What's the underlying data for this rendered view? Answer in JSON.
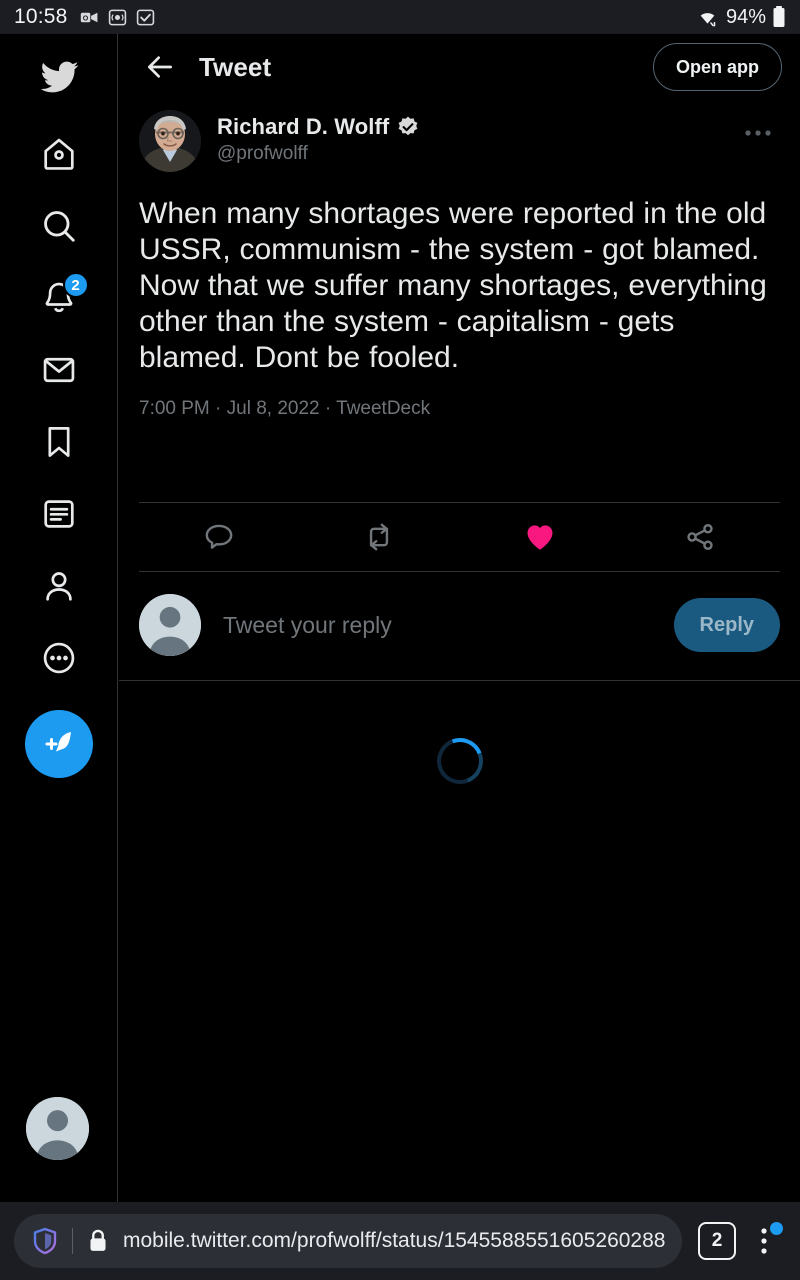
{
  "status_bar": {
    "clock": "10:58",
    "battery_percent": "94%",
    "icons": [
      "outlook-video-icon",
      "screen-record-icon",
      "checkbox-icon"
    ],
    "right_icons": [
      "wifi-icon",
      "battery-icon"
    ],
    "bg_color": "#1b1d22"
  },
  "sidebar": {
    "logo": "twitter-bird-logo",
    "items": [
      {
        "name": "home",
        "icon": "home-icon",
        "badge": ""
      },
      {
        "name": "explore",
        "icon": "search-icon",
        "badge": ""
      },
      {
        "name": "notifications",
        "icon": "bell-icon",
        "badge": "2"
      },
      {
        "name": "messages",
        "icon": "envelope-icon",
        "badge": ""
      },
      {
        "name": "bookmarks",
        "icon": "bookmark-icon",
        "badge": ""
      },
      {
        "name": "lists",
        "icon": "list-icon",
        "badge": ""
      },
      {
        "name": "profile",
        "icon": "person-icon",
        "badge": ""
      },
      {
        "name": "more",
        "icon": "more-circle-icon",
        "badge": ""
      }
    ],
    "compose_icon": "compose-feather-icon",
    "account_avatar": "default-avatar"
  },
  "header": {
    "back_icon": "back-arrow-icon",
    "title": "Tweet",
    "open_app_label": "Open app"
  },
  "tweet": {
    "author_name": "Richard D. Wolff",
    "author_handle": "@profwolff",
    "verified": true,
    "verified_icon": "verified-badge-icon",
    "more_icon": "more-horizontal-icon",
    "text": "When many shortages were reported in the old USSR, communism - the system - got blamed. Now that we suffer many shortages, everything other than the system - capitalism - gets blamed. Dont be fooled.",
    "timestamp": "7:00 PM · Jul 8, 2022 · TweetDeck",
    "actions": [
      {
        "name": "reply",
        "icon": "comment-icon",
        "active": false
      },
      {
        "name": "retweet",
        "icon": "retweet-icon",
        "active": false
      },
      {
        "name": "like",
        "icon": "heart-icon",
        "active": true
      },
      {
        "name": "share",
        "icon": "share-icon",
        "active": false
      }
    ],
    "like_color": "#f91880"
  },
  "reply_composer": {
    "avatar": "default-avatar",
    "placeholder": "Tweet your reply",
    "button_label": "Reply"
  },
  "loading": {
    "spinner": "loading-spinner",
    "accent": "#1d9bf0"
  },
  "browser_bar": {
    "shield_icon": "brave-shield-icon",
    "lock_icon": "lock-icon",
    "url": "mobile.twitter.com/profwolff/status/1545588551605260288",
    "tab_count": "2",
    "menu_icon": "more-vertical-icon",
    "has_menu_badge": true
  },
  "theme": {
    "accent": "#1d9bf0",
    "bg": "#000000",
    "border": "#2f3336",
    "muted": "#71767b"
  }
}
